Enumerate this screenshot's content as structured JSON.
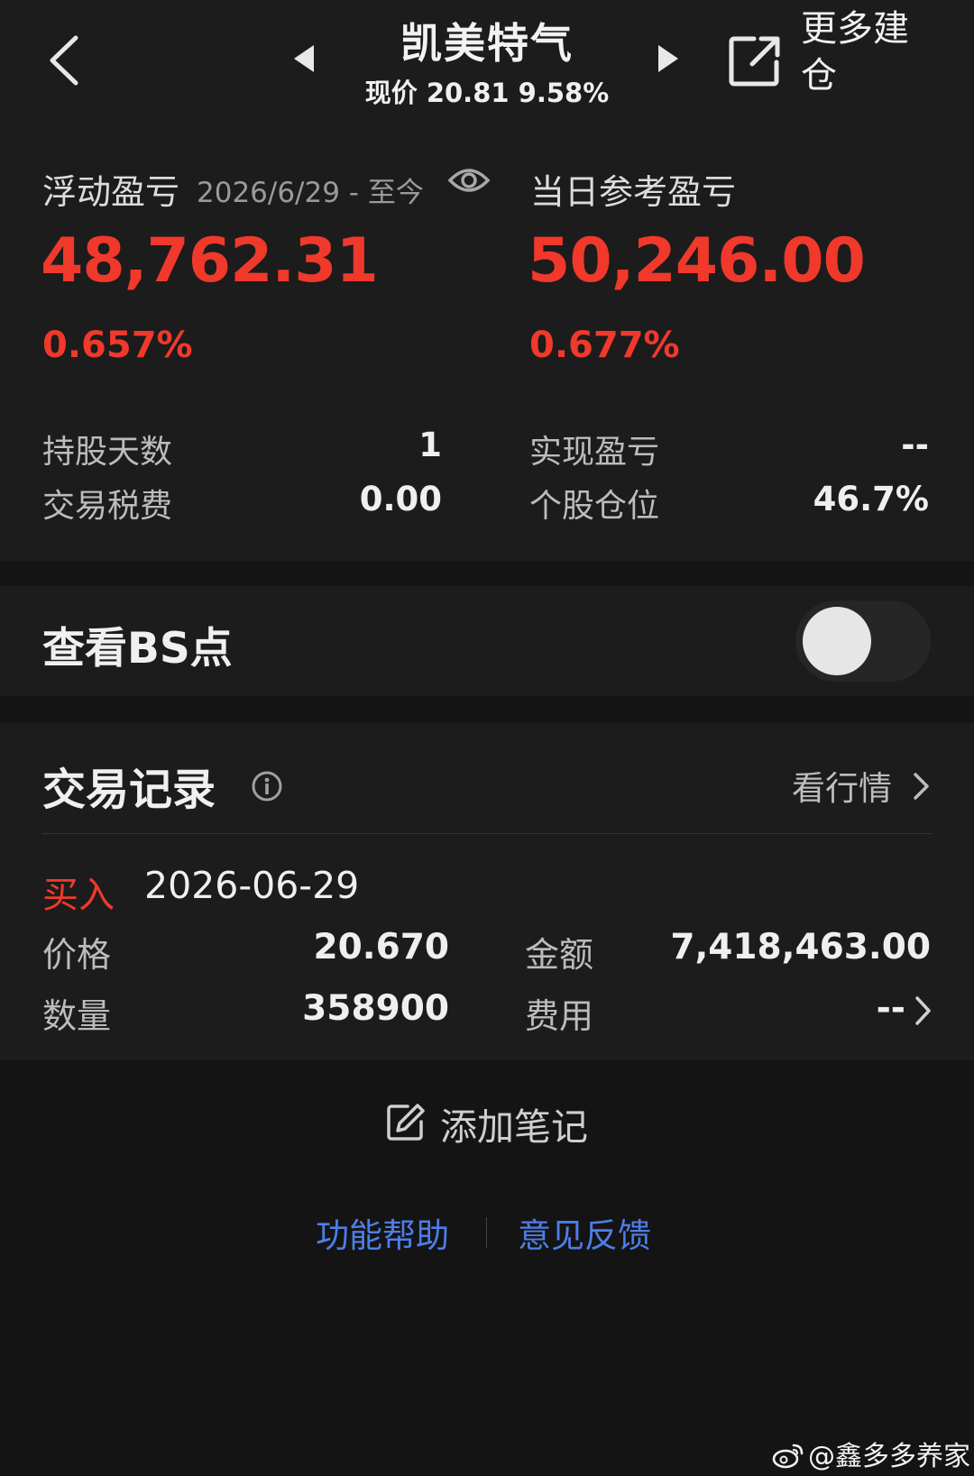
{
  "header": {
    "stock_name": "凯美特气",
    "price_line": "现价 20.81 9.58%",
    "more_label": "更多建仓"
  },
  "summary": {
    "float_label": "浮动盈亏",
    "float_period": "2026/6/29 - 至今",
    "float_value": "48,762.31",
    "float_pct": "0.657%",
    "today_label": "当日参考盈亏",
    "today_value": "50,246.00",
    "today_pct": "0.677%",
    "stats_left": [
      {
        "label": "持股天数",
        "value": "1"
      },
      {
        "label": "交易税费",
        "value": "0.00"
      }
    ],
    "stats_right": [
      {
        "label": "实现盈亏",
        "value": "--"
      },
      {
        "label": "个股仓位",
        "value": "46.7%"
      }
    ]
  },
  "bs_point": {
    "label": "查看BS点",
    "enabled": false
  },
  "trades": {
    "title": "交易记录",
    "market_link": "看行情",
    "record": {
      "type": "买入",
      "date": "2026-06-29",
      "price_label": "价格",
      "price": "20.670",
      "amount_label": "金额",
      "amount": "7,418,463.00",
      "qty_label": "数量",
      "qty": "358900",
      "fee_label": "费用",
      "fee": "--"
    }
  },
  "note": {
    "label": "添加笔记"
  },
  "footer": {
    "help": "功能帮助",
    "feedback": "意见反馈"
  },
  "watermark": "@鑫多多养家",
  "colors": {
    "loss_profit_red": "#f0392b",
    "link_blue": "#4d7ee8",
    "background": "#141414",
    "card": "#1c1c1c"
  }
}
